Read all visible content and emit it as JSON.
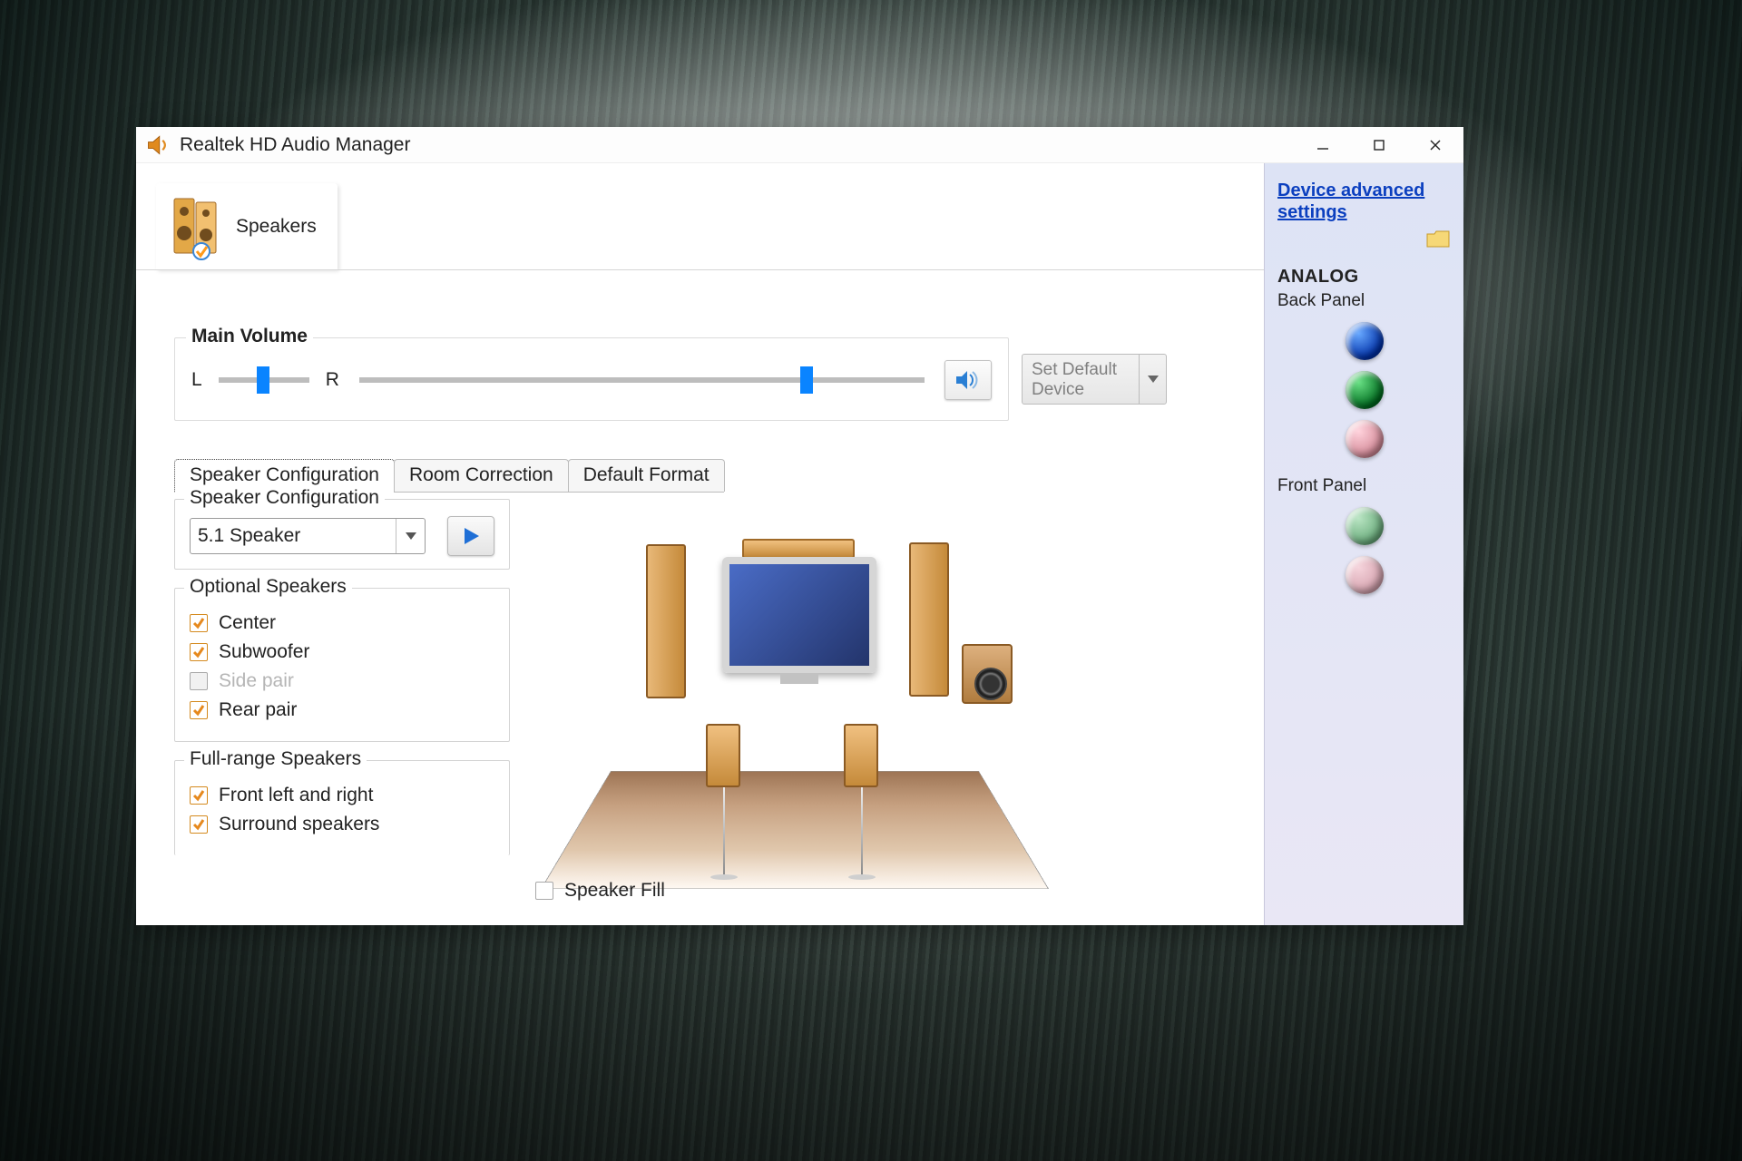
{
  "window_title": "Realtek HD Audio Manager",
  "device_tab": {
    "label": "Speakers"
  },
  "main_volume": {
    "title": "Main Volume",
    "balance_left": "L",
    "balance_right": "R",
    "balance_pos_pct": 42,
    "volume_pos_pct": 78
  },
  "default_device": {
    "label_line1": "Set Default",
    "label_line2": "Device"
  },
  "tabs": {
    "speaker_config": "Speaker Configuration",
    "room_correction": "Room Correction",
    "default_format": "Default Format"
  },
  "speaker_config": {
    "fieldset": "Speaker Configuration",
    "selected": "5.1 Speaker"
  },
  "optional_speakers": {
    "fieldset": "Optional Speakers",
    "center": "Center",
    "subwoofer": "Subwoofer",
    "side_pair": "Side pair",
    "rear_pair": "Rear pair"
  },
  "full_range": {
    "fieldset": "Full-range Speakers",
    "front_lr": "Front left and right",
    "surround": "Surround speakers"
  },
  "speaker_fill": {
    "label": "Speaker Fill"
  },
  "side": {
    "adv_link": "Device advanced settings",
    "analog": "ANALOG",
    "back_panel": "Back Panel",
    "front_panel": "Front Panel"
  }
}
